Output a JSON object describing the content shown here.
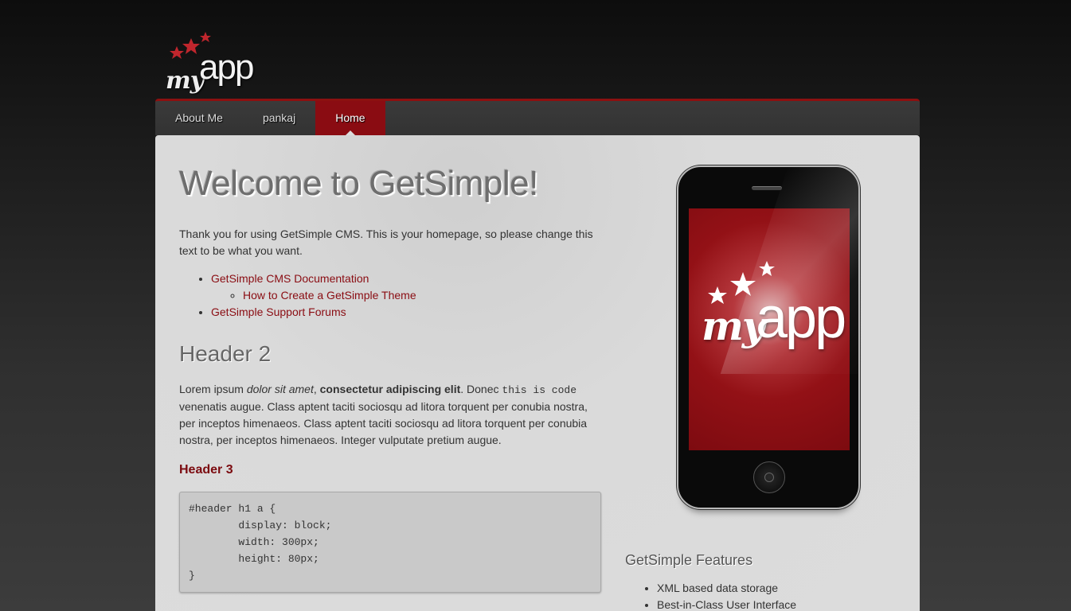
{
  "logo": {
    "text_my": "my",
    "text_app": "app"
  },
  "nav": {
    "items": [
      {
        "label": "About Me",
        "current": false
      },
      {
        "label": "pankaj",
        "current": false
      },
      {
        "label": "Home",
        "current": true
      }
    ]
  },
  "main": {
    "title": "Welcome to GetSimple!",
    "intro": "Thank you for using GetSimple CMS. This is your homepage, so please change this text to be what you want.",
    "links": {
      "doc": "GetSimple CMS Documentation",
      "theme": "How to Create a GetSimple Theme",
      "forums": "GetSimple Support Forums"
    },
    "header2": "Header 2",
    "lorem": {
      "part1": "Lorem ipsum ",
      "italic": "dolor sit amet",
      "comma": ", ",
      "bold": "consectetur adipiscing elit",
      "part2": ". Donec ",
      "code": "this is code",
      "part3": " venenatis augue. Class aptent taciti sociosqu ad litora torquent per conubia nostra, per inceptos himenaeos. Class aptent taciti sociosqu ad litora torquent per conubia nostra, per inceptos himenaeos. Integer vulputate pretium augue."
    },
    "header3": "Header 3",
    "code_block": "#header h1 a {\n        display: block;\n        width: 300px;\n        height: 80px;\n}"
  },
  "sidebar": {
    "phone_logo": {
      "text_my": "my",
      "text_app": "app"
    },
    "features_title": "GetSimple Features",
    "features": [
      "XML based data storage",
      "Best-in-Class User Interface"
    ]
  },
  "colors": {
    "accent": "#8a0c12",
    "link": "#8a0c12",
    "header3": "#7b0a0f"
  }
}
